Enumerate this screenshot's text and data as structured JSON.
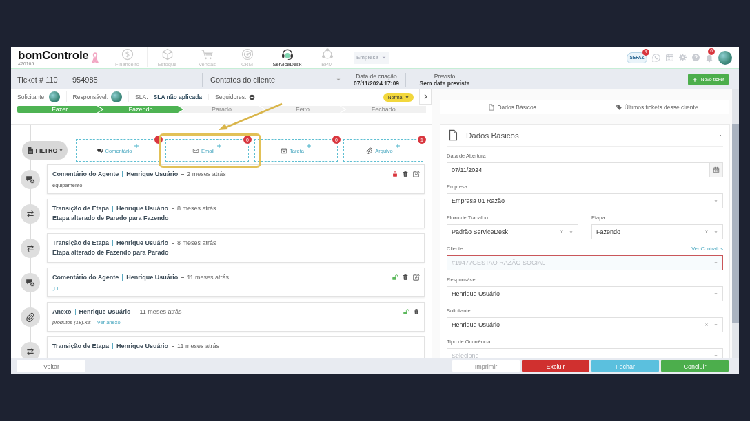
{
  "header": {
    "logo": "bomControle",
    "build": "#76165",
    "modules": [
      {
        "kind": "finance",
        "label": "Financeiro",
        "selected": false
      },
      {
        "kind": "stock",
        "label": "Estoque",
        "selected": false
      },
      {
        "kind": "sales",
        "label": "Vendas",
        "selected": false
      },
      {
        "kind": "crm",
        "label": "CRM",
        "selected": false
      },
      {
        "kind": "desk",
        "label": "ServiceDesk",
        "selected": true
      },
      {
        "kind": "bpm",
        "label": "BPM",
        "selected": false
      }
    ],
    "company_select": "Empresa",
    "sefaz": {
      "label": "SEFAZ",
      "badge": "4"
    },
    "notifications_badge": "6"
  },
  "ticket_bar": {
    "ticket": "Ticket # 110",
    "code": "954985",
    "contacts": "Contatos do cliente",
    "created_label": "Data de criação",
    "created_value": "07/11/2024 17:09",
    "forecast_label": "Previsto",
    "forecast_value": "Sem data prevista",
    "new_button": "Novo ticket"
  },
  "info": {
    "requester_label": "Solicitante:",
    "owner_label": "Responsável:",
    "sla_label": "SLA:",
    "sla_value": "SLA não aplicada",
    "followers_label": "Seguidores:",
    "priority": "Normal"
  },
  "stages": [
    {
      "label": "Fazer",
      "done": true
    },
    {
      "label": "Fazendo",
      "done": true
    },
    {
      "label": "Parado",
      "done": false
    },
    {
      "label": "Feito",
      "done": false
    },
    {
      "label": "Fechado",
      "done": false
    }
  ],
  "filter": "FILTRO",
  "actions": [
    {
      "kind": "comment",
      "label": "Comentário"
    },
    {
      "kind": "email",
      "label": "Email",
      "count": "0"
    },
    {
      "kind": "task",
      "label": "Tarefa",
      "count": "0"
    },
    {
      "kind": "file",
      "label": "Arquivo",
      "count": "1"
    }
  ],
  "timeline": [
    {
      "kind": "comment",
      "title": "Comentário do Agente",
      "author": "Henrique Usuário",
      "time": "2 meses atrás",
      "body": "equipamento",
      "locked": true,
      "editable": true
    },
    {
      "kind": "transition",
      "title": "Transição de Etapa",
      "author": "Henrique Usuário",
      "time": "8 meses atrás",
      "body": "Etapa alterado de Parado para Fazendo"
    },
    {
      "kind": "transition",
      "title": "Transição de Etapa",
      "author": "Henrique Usuário",
      "time": "8 meses atrás",
      "body": "Etapa alterado de Fazendo para Parado"
    },
    {
      "kind": "comment",
      "title": "Comentário do Agente",
      "author": "Henrique Usuário",
      "time": "11 meses atrás",
      "body": ",LI",
      "locked": false,
      "editable": true
    },
    {
      "kind": "attachment",
      "title": "Anexo",
      "author": "Henrique Usuário",
      "time": "11 meses atrás",
      "file": "produtos (18).xls",
      "link": "Ver anexo",
      "locked": false,
      "editable": false
    },
    {
      "kind": "transition",
      "title": "Transição de Etapa",
      "author": "Henrique Usuário",
      "time": "11 meses atrás"
    }
  ],
  "back_button": "Voltar",
  "panel": {
    "tabs": [
      {
        "kind": "basic",
        "label": "Dados Básicos"
      },
      {
        "kind": "tag",
        "label": "Últimos tickets desse cliente"
      }
    ],
    "section": {
      "title": "Dados Básicos",
      "expanded": true,
      "fields": [
        {
          "kind": "date",
          "label": "Data de Abertura",
          "value": "07/11/2024"
        },
        {
          "kind": "select",
          "label": "Empresa",
          "value": "Empresa 01 Razão"
        },
        {
          "kind": "select",
          "label": "Fluxo de Trabalho",
          "value": "Padrão ServiceDesk",
          "clearable": true,
          "half": true
        },
        {
          "kind": "select",
          "label": "Etapa",
          "value": "Fazendo",
          "clearable": true,
          "half": true
        },
        {
          "kind": "select",
          "label": "Cliente",
          "link": "Ver Contratos",
          "value": "#19477GESTAO RAZÃO SOCIAL",
          "invalid": true
        },
        {
          "kind": "select",
          "label": "Responsável",
          "value": "Henrique Usuário"
        },
        {
          "kind": "select",
          "label": "Solicitante",
          "value": "Henrique Usuário",
          "clearable": true
        },
        {
          "kind": "select",
          "label": "Tipo de Ocorrência",
          "placeholder": "Selecione"
        }
      ]
    }
  },
  "buttons": [
    {
      "kind": "default",
      "label": "Imprimir"
    },
    {
      "kind": "danger",
      "label": "Excluir"
    },
    {
      "kind": "info",
      "label": "Fechar"
    },
    {
      "kind": "success",
      "label": "Concluir"
    }
  ]
}
